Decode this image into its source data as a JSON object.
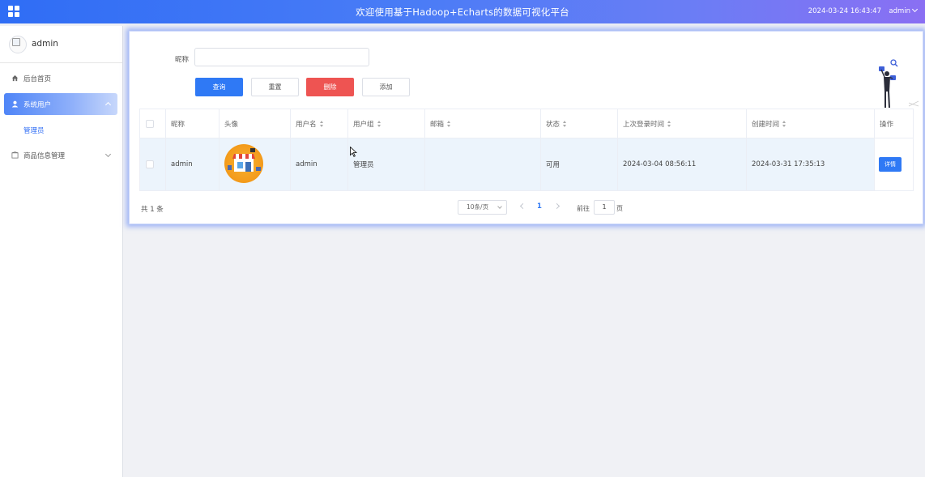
{
  "header": {
    "title": "欢迎使用基于Hadoop+Echarts的数据可视化平台",
    "datetime": "2024-03-24 16:43:47",
    "user": "admin",
    "gradient_start": "#2f6df5",
    "gradient_end": "#8a6ff3"
  },
  "sidebar": {
    "username": "admin",
    "items": [
      {
        "label": "后台首页",
        "icon": "home-icon"
      },
      {
        "label": "系统用户",
        "icon": "user-icon",
        "active": true,
        "expanded": true,
        "children": [
          {
            "label": "管理员"
          }
        ]
      },
      {
        "label": "商品信息管理",
        "icon": "box-icon"
      }
    ]
  },
  "search": {
    "label": "昵称",
    "value": "",
    "placeholder": ""
  },
  "buttons": {
    "query": "查询",
    "reset": "重置",
    "delete": "删除",
    "add": "添加"
  },
  "table": {
    "columns": [
      "昵称",
      "头像",
      "用户名",
      "用户组",
      "邮箱",
      "状态",
      "上次登录时间",
      "创建时间",
      "操作"
    ],
    "rows": [
      {
        "nickname": "admin",
        "username": "admin",
        "group": "管理员",
        "email": "",
        "status": "可用",
        "last_login": "2024-03-04 08:56:11",
        "created": "2024-03-31 17:35:13",
        "action": "详情"
      }
    ]
  },
  "pagination": {
    "total": "共 1 条",
    "page_size": "10条/页",
    "current_page": "1",
    "goto_label": "前往",
    "goto_value": "1",
    "goto_unit": "页"
  },
  "colors": {
    "primary": "#2f79f5",
    "danger": "#ee5452",
    "row_highlight": "#ecf4fc"
  }
}
